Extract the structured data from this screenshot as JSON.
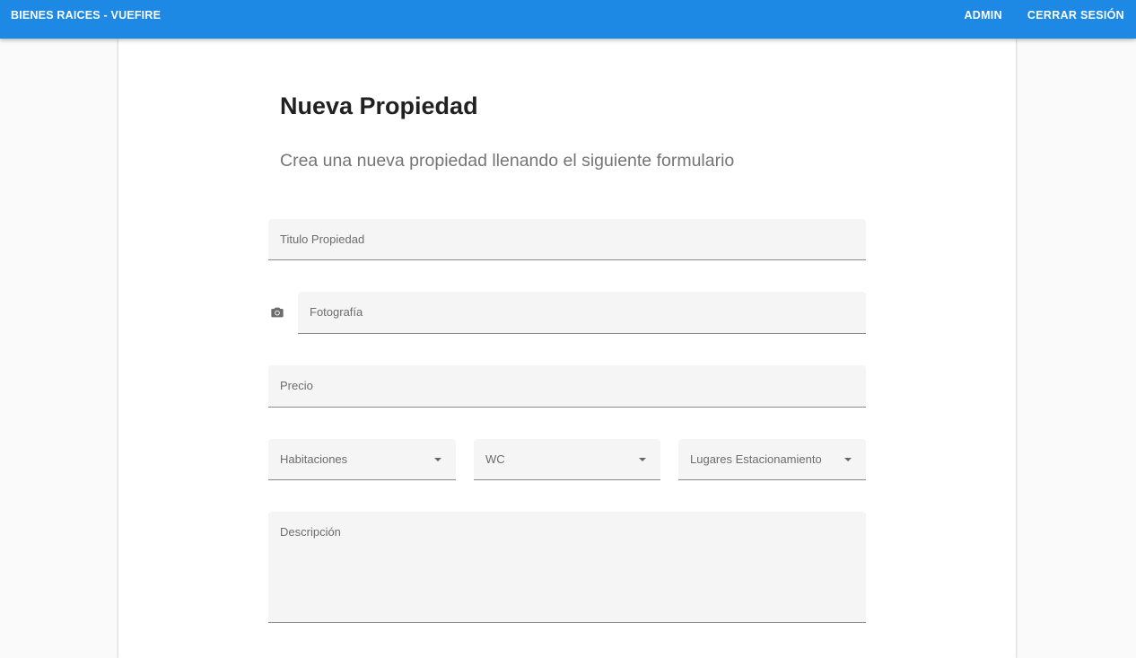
{
  "appbar": {
    "brand": "BIENES RAICES - VUEFIRE",
    "nav": [
      "ADMIN",
      "CERRAR SESIÓN"
    ]
  },
  "form": {
    "title": "Nueva Propiedad",
    "subtitle": "Crea una nueva propiedad llenando el siguiente formulario",
    "fields": {
      "titulo": "Titulo Propiedad",
      "foto": "Fotografía",
      "precio": "Precio",
      "habitaciones": "Habitaciones",
      "wc": "WC",
      "estacionamiento": "Lugares Estacionamiento",
      "descripcion": "Descripción"
    },
    "icons": {
      "foto": "camera-icon",
      "select": "arrow-drop-down-icon"
    }
  },
  "colors": {
    "primary": "#1e88e5"
  }
}
